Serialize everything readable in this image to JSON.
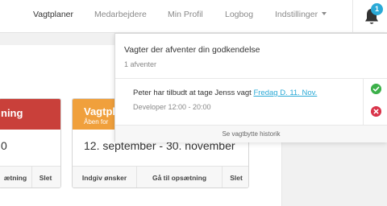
{
  "nav": {
    "items": [
      {
        "label": "Vagtplaner",
        "active": true
      },
      {
        "label": "Medarbejdere",
        "active": false
      },
      {
        "label": "Min Profil",
        "active": false
      },
      {
        "label": "Logbog",
        "active": false
      },
      {
        "label": "Indstillinger",
        "active": false
      }
    ],
    "notification_count": "1"
  },
  "cards": [
    {
      "title": "ning",
      "subtitle": "",
      "period": "0",
      "color": "#c9403a",
      "actions": [
        "ætning",
        "Slet"
      ]
    },
    {
      "title": "Vagtplan",
      "subtitle": "Åben for",
      "period": "12. september - 30. november",
      "color": "#f0a03c",
      "actions": [
        "Indgiv ønsker",
        "Gå til opsætning",
        "Slet"
      ]
    }
  ],
  "dropdown": {
    "title": "Vagter der afventer din godkendelse",
    "count": "1 afventer",
    "item": {
      "text": "Peter har tilbudt at tage Jenss vagt ",
      "link": "Fredag D. 11. Nov.",
      "detail": "Developer 12:00 - 20:00"
    },
    "footer": "Se vagtbytte historik"
  },
  "colors": {
    "accent": "#2aa9d6",
    "accept": "#3cb04a",
    "reject": "#d9344a"
  },
  "icons": {
    "bell": "bell-icon",
    "accept": "check-circle-icon",
    "reject": "x-circle-icon"
  }
}
